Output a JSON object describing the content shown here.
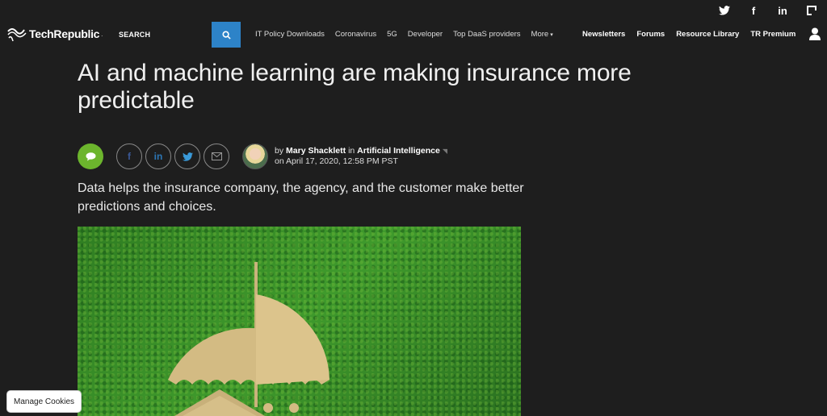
{
  "top_social": [
    {
      "name": "twitter",
      "glyph": "🐦"
    },
    {
      "name": "facebook",
      "glyph": "f"
    },
    {
      "name": "linkedin",
      "glyph": "in"
    },
    {
      "name": "flipboard",
      "glyph": "▛"
    }
  ],
  "header": {
    "logo_text": "TechRepublic",
    "logo_suffix": ".",
    "search_label": "SEARCH",
    "nav": [
      "IT Policy Downloads",
      "Coronavirus",
      "5G",
      "Developer",
      "Top DaaS providers",
      "More"
    ],
    "nav_right": [
      "Newsletters",
      "Forums",
      "Resource Library",
      "TR Premium"
    ],
    "accent_color": "#2d83c8"
  },
  "article": {
    "headline": "AI and machine learning are making insurance more predictable",
    "by_prefix": "by",
    "author": "Mary Shacklett",
    "in_word": "in",
    "category": "Artificial Intelligence",
    "date": "on April 17, 2020, 12:58 PM PST",
    "dek": "Data helps the insurance company, the agency, and the customer make better predictions and choices.",
    "share_icons": [
      "f",
      "in",
      "t",
      "✉"
    ]
  },
  "cookies_label": "Manage Cookies"
}
